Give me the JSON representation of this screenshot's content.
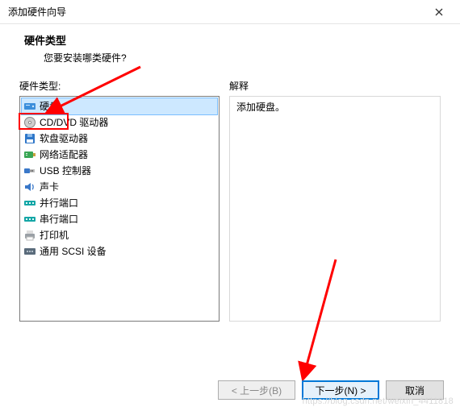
{
  "titlebar": {
    "title": "添加硬件向导"
  },
  "header": {
    "heading": "硬件类型",
    "subheading": "您要安装哪类硬件?"
  },
  "left": {
    "label": "硬件类型:",
    "items": [
      {
        "icon": "hdd",
        "label": "硬盘",
        "selected": true
      },
      {
        "icon": "disc",
        "label": "CD/DVD 驱动器",
        "selected": false
      },
      {
        "icon": "floppy",
        "label": "软盘驱动器",
        "selected": false
      },
      {
        "icon": "nic",
        "label": "网络适配器",
        "selected": false
      },
      {
        "icon": "usb",
        "label": "USB 控制器",
        "selected": false
      },
      {
        "icon": "sound",
        "label": "声卡",
        "selected": false
      },
      {
        "icon": "port",
        "label": "并行端口",
        "selected": false
      },
      {
        "icon": "port",
        "label": "串行端口",
        "selected": false
      },
      {
        "icon": "printer",
        "label": "打印机",
        "selected": false
      },
      {
        "icon": "scsi",
        "label": "通用 SCSI 设备",
        "selected": false
      }
    ]
  },
  "right": {
    "label": "解释",
    "description": "添加硬盘。"
  },
  "buttons": {
    "back": "< 上一步(B)",
    "next": "下一步(N) >",
    "cancel": "取消"
  },
  "watermark": "https://blog.csdn.net/weixin_4411818"
}
